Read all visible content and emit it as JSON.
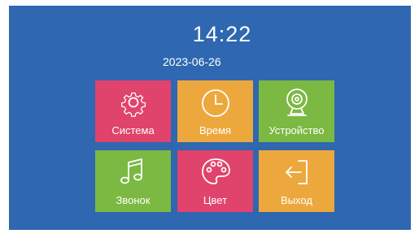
{
  "status": {
    "time": "14:22",
    "date": "2023-06-26"
  },
  "menu": {
    "items": [
      {
        "id": "system",
        "label": "Система",
        "icon": "gear-icon",
        "color": "#e0436b"
      },
      {
        "id": "time",
        "label": "Время",
        "icon": "clock-icon",
        "color": "#eda83d"
      },
      {
        "id": "device",
        "label": "Устройство",
        "icon": "webcam-icon",
        "color": "#7bb942"
      },
      {
        "id": "ringtone",
        "label": "Звонок",
        "icon": "music-note-icon",
        "color": "#7bb942"
      },
      {
        "id": "color",
        "label": "Цвет",
        "icon": "palette-icon",
        "color": "#e0436b"
      },
      {
        "id": "exit",
        "label": "Выход",
        "icon": "exit-icon",
        "color": "#eda83d"
      }
    ]
  },
  "colors": {
    "background": "#2f67b0",
    "text": "#ffffff"
  }
}
